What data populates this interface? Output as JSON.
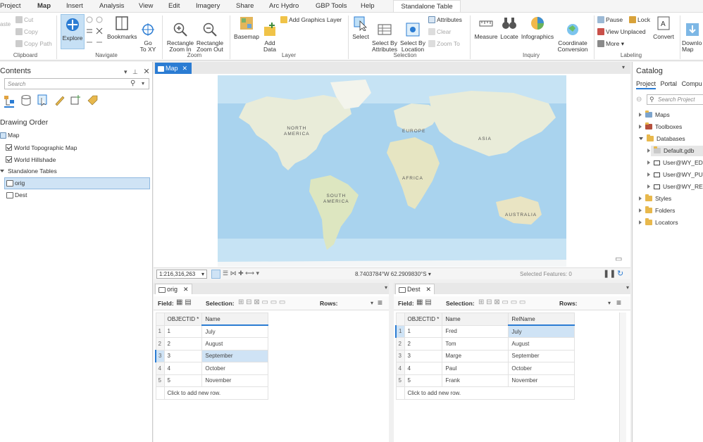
{
  "menu": {
    "items": [
      "Project",
      "Map",
      "Insert",
      "Analysis",
      "View",
      "Edit",
      "Imagery",
      "Share",
      "Arc Hydro",
      "GBP Tools",
      "Help"
    ],
    "context_tab": "Standalone Table"
  },
  "ribbon": {
    "clipboard": {
      "paste": "aste",
      "cut": "Cut",
      "copy": "Copy",
      "copy_path": "Copy Path",
      "label": "Clipboard"
    },
    "navigate": {
      "explore": "Explore",
      "bookmarks": "Bookmarks",
      "goto": "Go\nTo XY",
      "label": "Navigate"
    },
    "zoom": {
      "zoom_in": "Rectangle\nZoom In",
      "zoom_out": "Rectangle\nZoom Out",
      "label": "Zoom"
    },
    "layer": {
      "basemap": "Basemap",
      "add_data": "Add\nData",
      "add_graphics": "Add Graphics Layer",
      "label": "Layer"
    },
    "selection": {
      "select": "Select",
      "by_attr": "Select By\nAttributes",
      "by_loc": "Select By\nLocation",
      "attributes": "Attributes",
      "clear": "Clear",
      "zoom_to": "Zoom To",
      "label": "Selection"
    },
    "inquiry": {
      "measure": "Measure",
      "locate": "Locate",
      "infographics": "Infographics",
      "coord": "Coordinate\nConversion",
      "label": "Inquiry"
    },
    "labeling": {
      "pause": "Pause",
      "lock": "Lock",
      "view_unplaced": "View Unplaced",
      "more": "More",
      "convert": "Convert",
      "label": "Labeling"
    },
    "download": "Downlo\nMap"
  },
  "contents": {
    "title": "Contents",
    "search_placeholder": "Search",
    "drawing_order": "Drawing Order",
    "map": "Map",
    "layers": [
      "World Topographic Map",
      "World Hillshade"
    ],
    "standalone_tables": "Standalone Tables",
    "tables": [
      "orig",
      "Dest"
    ]
  },
  "map": {
    "tab": "Map",
    "labels": {
      "na": "NORTH\nAMERICA",
      "sa": "SOUTH\nAMERICA",
      "eu": "EUROPE",
      "af": "AFRICA",
      "as": "ASIA",
      "au": "AUSTRALIA"
    },
    "scale": "1:216,316,263",
    "coords": "8.7403784°W 62.2909830°S",
    "selected_features": "Selected Features: 0"
  },
  "orig_table": {
    "tab": "orig",
    "field_label": "Field:",
    "selection_label": "Selection:",
    "rows_label": "Rows:",
    "headers": [
      "OBJECTID *",
      "Name"
    ],
    "rows": [
      [
        "1",
        "1",
        "July"
      ],
      [
        "2",
        "2",
        "August"
      ],
      [
        "3",
        "3",
        "September"
      ],
      [
        "4",
        "4",
        "October"
      ],
      [
        "5",
        "5",
        "November"
      ]
    ],
    "add_row": "Click to add new row."
  },
  "dest_table": {
    "tab": "Dest",
    "field_label": "Field:",
    "selection_label": "Selection:",
    "rows_label": "Rows:",
    "headers": [
      "OBJECTID *",
      "Name",
      "RelName"
    ],
    "rows": [
      [
        "1",
        "1",
        "Fred",
        "July"
      ],
      [
        "2",
        "2",
        "Tom",
        "August"
      ],
      [
        "3",
        "3",
        "Marge",
        "September"
      ],
      [
        "4",
        "4",
        "Paul",
        "October"
      ],
      [
        "5",
        "5",
        "Frank",
        "November"
      ]
    ],
    "add_row": "Click to add new row."
  },
  "catalog": {
    "title": "Catalog",
    "tabs": [
      "Project",
      "Portal",
      "Compu"
    ],
    "search_placeholder": "Search Project",
    "items": [
      "Maps",
      "Toolboxes",
      "Databases",
      "Default.gdb",
      "User@WY_EDI",
      "User@WY_PUI",
      "User@WY_REF",
      "Styles",
      "Folders",
      "Locators"
    ]
  },
  "colors": {
    "accent": "#2b7cd3",
    "selection": "#cfe3f5",
    "ocean": "#a9d3ee",
    "land": "#e9ecd9"
  }
}
